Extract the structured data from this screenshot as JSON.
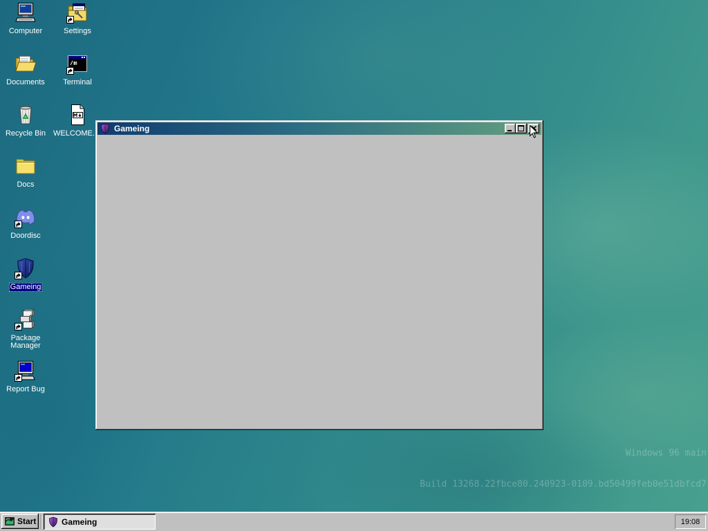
{
  "desktop": {
    "background_colors": [
      "#1c6a80",
      "#2e868b",
      "#48a08e"
    ],
    "icons": [
      {
        "label": "Computer",
        "icon": "computer-icon",
        "shortcut": false
      },
      {
        "label": "Settings",
        "icon": "settings-folder-icon",
        "shortcut": true
      },
      {
        "label": "Documents",
        "icon": "open-folder-icon",
        "shortcut": false
      },
      {
        "label": "Terminal",
        "icon": "terminal-icon",
        "shortcut": true
      },
      {
        "label": "Recycle Bin",
        "icon": "recycle-bin-icon",
        "shortcut": false
      },
      {
        "label": "WELCOME.",
        "icon": "markdown-file-icon",
        "shortcut": false
      },
      {
        "label": "Docs",
        "icon": "folder-icon",
        "shortcut": false
      },
      {
        "label": "Doordisc",
        "icon": "discord-icon",
        "shortcut": true
      },
      {
        "label": "Gameing",
        "icon": "shield-icon",
        "shortcut": true,
        "selected": true
      },
      {
        "label": "Package Manager",
        "icon": "package-icon",
        "shortcut": true
      },
      {
        "label": "Report Bug",
        "icon": "bug-report-computer-icon",
        "shortcut": true
      }
    ]
  },
  "window": {
    "title": "Gameing",
    "icon": "shield-icon",
    "active": true,
    "titlebar_colors": [
      "#0f3b6e",
      "#64a07e"
    ],
    "buttons": [
      "minimize-icon",
      "maximize-icon",
      "close-icon"
    ]
  },
  "watermark": {
    "line1": "Windows 96 main",
    "line2": "Build 13268.22fbce80.240923-0109.bd50499feb0e51dbfcd7"
  },
  "taskbar": {
    "start_label": "Start",
    "start_icon": "windows96-logo-icon",
    "tasks": [
      {
        "label": "Gameing",
        "icon": "shield-icon",
        "active": true
      }
    ],
    "clock": "19:08"
  },
  "cursor": {
    "icon": "arrow-cursor-icon"
  }
}
